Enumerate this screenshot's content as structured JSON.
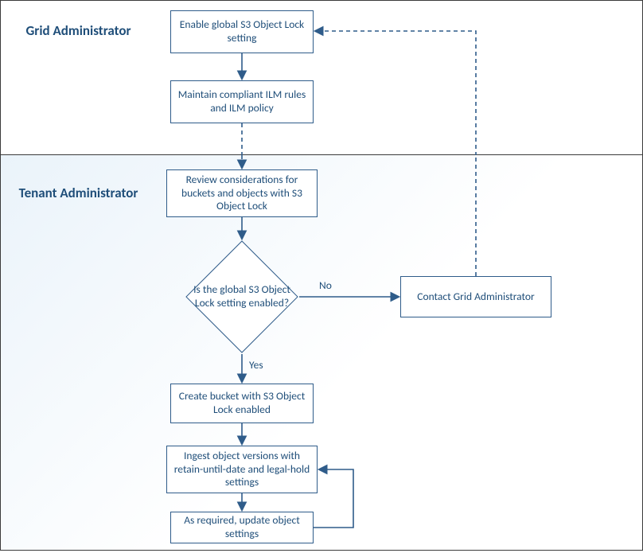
{
  "colors": {
    "border": "#2f5c8a",
    "text": "#1f4e79",
    "frame": "#3b3b3b",
    "gradient_start": "#eaf3fa",
    "gradient_end": "#ffffff"
  },
  "roles": {
    "grid": "Grid Administrator",
    "tenant": "Tenant Administrator"
  },
  "nodes": {
    "enable_global": "Enable global S3 Object Lock setting",
    "maintain_ilm": "Maintain compliant ILM rules and ILM policy",
    "review": "Review considerations for buckets and objects with S3 Object Lock",
    "decision": "Is the global S3 Object Lock setting enabled?",
    "contact_admin": "Contact Grid Administrator",
    "create_bucket": "Create bucket with S3 Object Lock enabled",
    "ingest": "Ingest object versions with retain-until-date and legal-hold settings",
    "update": "As required, update object settings"
  },
  "edges": {
    "no": "No",
    "yes": "Yes"
  }
}
